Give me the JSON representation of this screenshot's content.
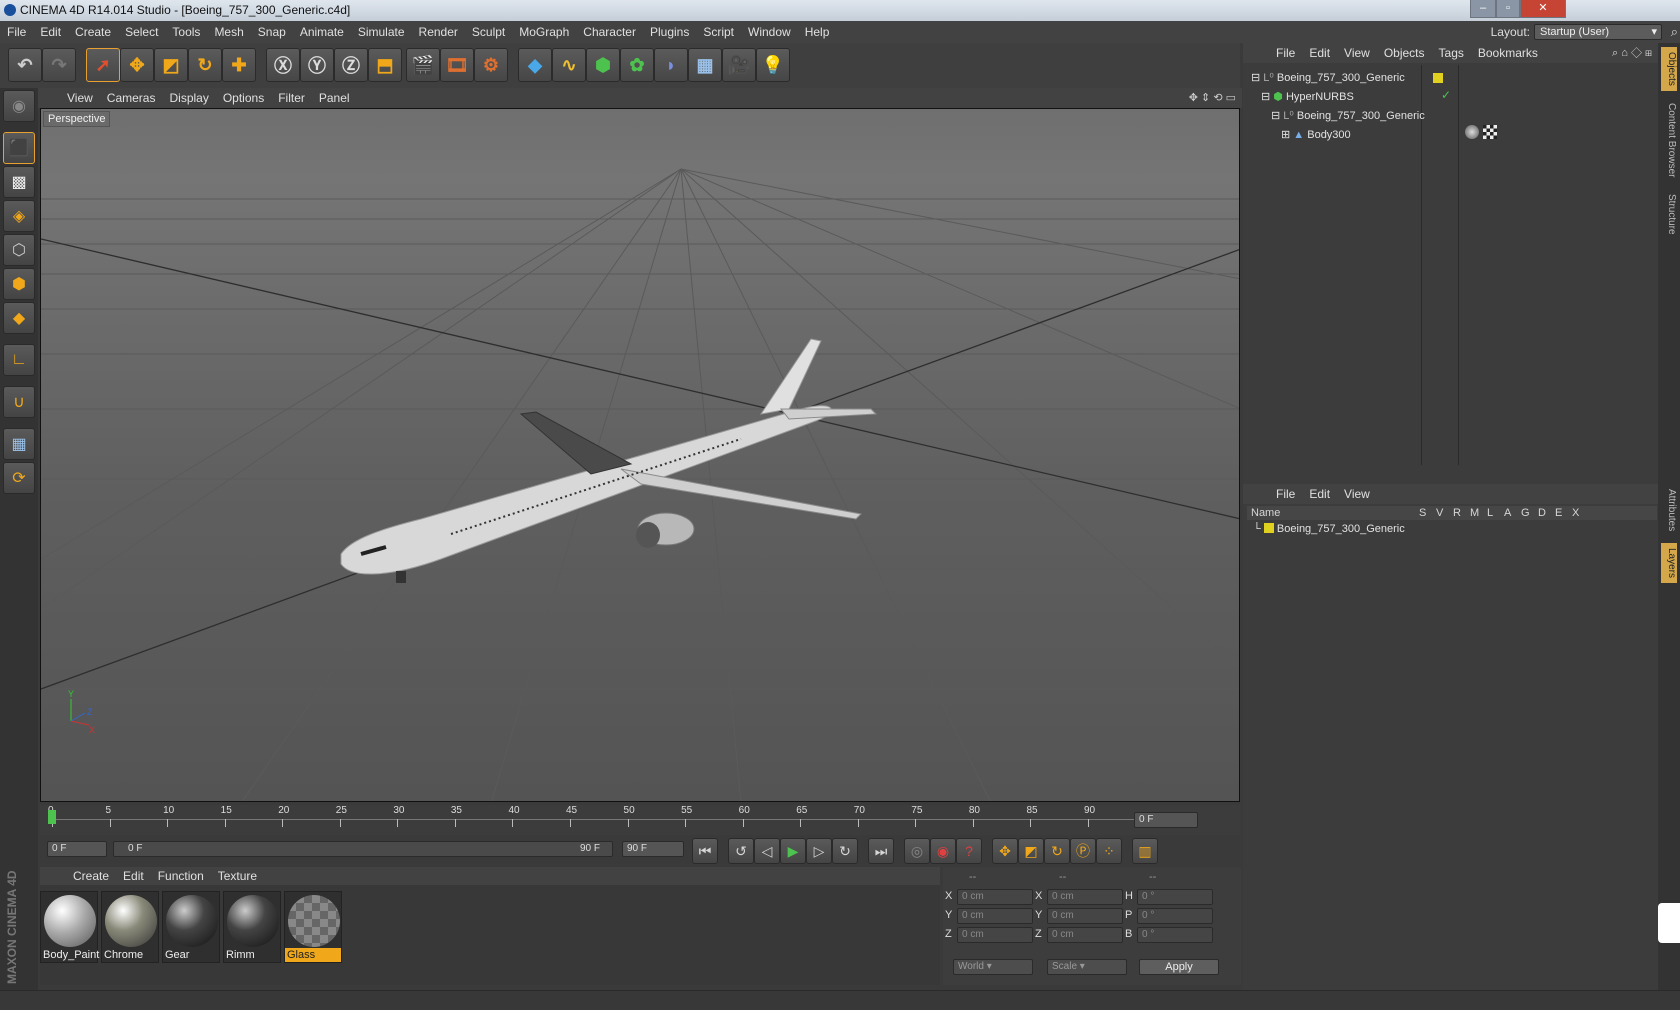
{
  "window": {
    "title": "CINEMA 4D R14.014 Studio - [Boeing_757_300_Generic.c4d]"
  },
  "menubar": {
    "items": [
      "File",
      "Edit",
      "Create",
      "Select",
      "Tools",
      "Mesh",
      "Snap",
      "Animate",
      "Simulate",
      "Render",
      "Sculpt",
      "MoGraph",
      "Character",
      "Plugins",
      "Script",
      "Window",
      "Help"
    ],
    "layout_label": "Layout:",
    "layout_value": "Startup (User)"
  },
  "viewport": {
    "menu": [
      "View",
      "Cameras",
      "Display",
      "Options",
      "Filter",
      "Panel"
    ],
    "label": "Perspective"
  },
  "timeline": {
    "ticks": [
      "0",
      "5",
      "10",
      "15",
      "20",
      "25",
      "30",
      "35",
      "40",
      "45",
      "50",
      "55",
      "60",
      "65",
      "70",
      "75",
      "80",
      "85",
      "90"
    ],
    "end_field": "0 F",
    "current_field": "0 F",
    "range_start": "0 F",
    "range_end": "90 F",
    "max_field": "90 F"
  },
  "materials": {
    "menu": [
      "Create",
      "Edit",
      "Function",
      "Texture"
    ],
    "items": [
      "Body_Paint",
      "Chrome",
      "Gear",
      "Rimm",
      "Glass"
    ]
  },
  "coords": {
    "headers": [
      "--",
      "--",
      "--"
    ],
    "rows": [
      {
        "a": "X",
        "av": "0 cm",
        "b": "X",
        "bv": "0 cm",
        "c": "H",
        "cv": "0 °"
      },
      {
        "a": "Y",
        "av": "0 cm",
        "b": "Y",
        "bv": "0 cm",
        "c": "P",
        "cv": "0 °"
      },
      {
        "a": "Z",
        "av": "0 cm",
        "b": "Z",
        "bv": "0 cm",
        "c": "B",
        "cv": "0 °"
      }
    ],
    "world": "World",
    "scale": "Scale",
    "apply": "Apply"
  },
  "objects": {
    "menu": [
      "File",
      "Edit",
      "View",
      "Objects",
      "Tags",
      "Bookmarks"
    ],
    "tree": [
      "Boeing_757_300_Generic",
      "HyperNURBS",
      "Boeing_757_300_Generic",
      "Body300"
    ]
  },
  "layers": {
    "menu": [
      "File",
      "Edit",
      "View"
    ],
    "name_header": "Name",
    "columns": [
      "S",
      "V",
      "R",
      "M",
      "L",
      "A",
      "G",
      "D",
      "E",
      "X"
    ],
    "row": "Boeing_757_300_Generic"
  },
  "side_tabs": [
    "Objects",
    "Content Browser",
    "Structure",
    "Attributes",
    "Layers"
  ],
  "brand": "MAXON CINEMA 4D",
  "colors": {
    "accent": "#f0a81a",
    "active_tab": "#d4a84a",
    "play_green": "#4ec24e"
  }
}
